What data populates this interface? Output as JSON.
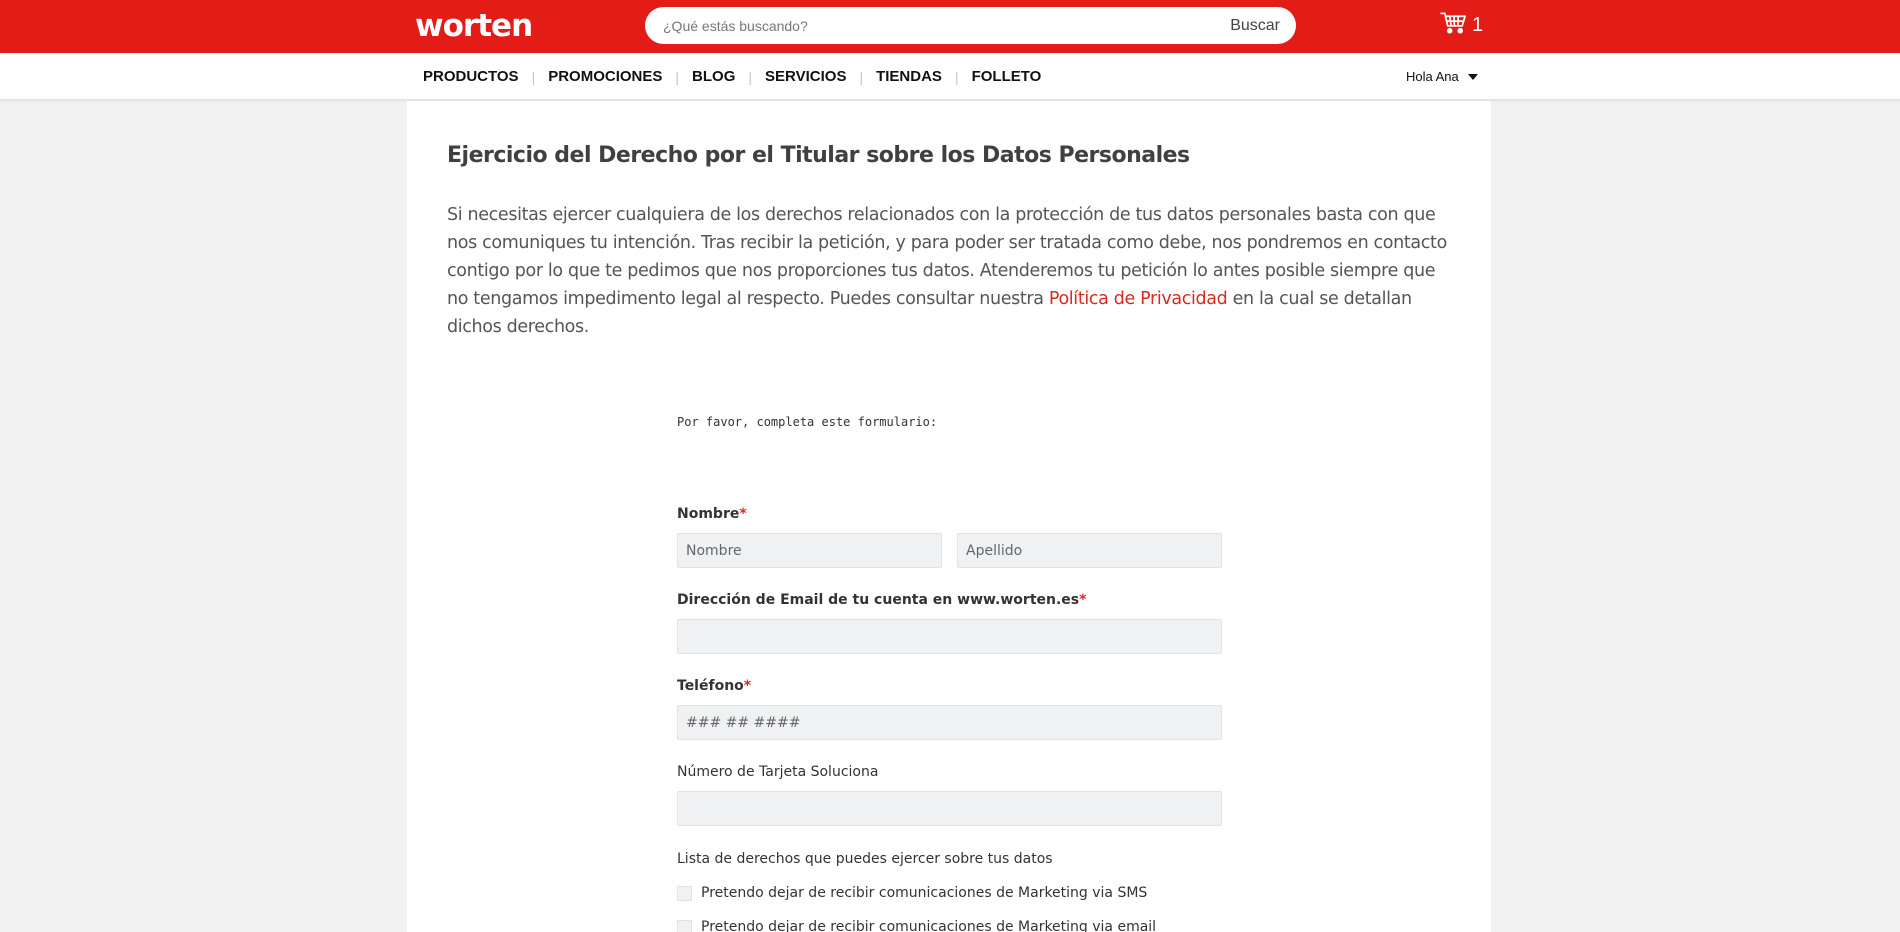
{
  "header": {
    "logo": "worten",
    "search_placeholder": "¿Qué estás buscando?",
    "search_button": "Buscar",
    "cart_count": "1"
  },
  "nav": {
    "items": [
      "PRODUCTOS",
      "PROMOCIONES",
      "BLOG",
      "SERVICIOS",
      "TIENDAS",
      "FOLLETO"
    ],
    "separator": "|",
    "user_greeting": "Hola Ana"
  },
  "page": {
    "title": "Ejercicio del Derecho por el Titular sobre los Datos Personales",
    "intro_before_link": "Si necesitas ejercer cualquiera de los derechos relacionados con la protección de tus datos personales basta con que nos comuniques tu intención. Tras recibir la petición, y para poder ser tratada como debe, nos pondremos en contacto contigo por lo que te pedimos que nos proporciones tus datos. Atenderemos tu petición lo antes posible siempre que no tengamos impedimento legal al respecto. Puedes consultar nuestra ",
    "intro_link": "Política de Privacidad",
    "intro_after_link": " en la cual se detallan dichos derechos."
  },
  "form": {
    "intro": "Por favor, completa este formulario:",
    "required_marker": "*",
    "name_label": "Nombre",
    "first_name_placeholder": "Nombre",
    "last_name_placeholder": "Apellido",
    "email_label": "Dirección de Email de tu cuenta en www.worten.es",
    "email_value": "",
    "phone_label": "Teléfono",
    "phone_placeholder": "### ## ####",
    "card_label": "Número de Tarjeta Soluciona",
    "card_value": "",
    "rights_label": "Lista de derechos que puedes ejercer sobre tus datos",
    "rights_options": [
      "Pretendo dejar de recibir comunicaciones de Marketing via SMS",
      "Pretendo dejar de recibir comunicaciones de Marketing via email"
    ]
  },
  "colors": {
    "brand_red": "#e41c17",
    "link_red": "#d62a23",
    "field_background": "#f0f1f3"
  },
  "icons": {
    "cart": "shopping-cart-icon",
    "user_menu": "caret-down-icon"
  }
}
